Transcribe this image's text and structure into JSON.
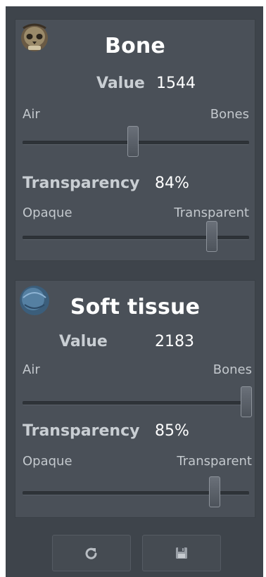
{
  "panels": [
    {
      "title": "Bone",
      "icon": "skull-icon",
      "value_label": "Value",
      "value": "1544",
      "value_slider": {
        "min_label": "Air",
        "max_label": "Bones",
        "level": 0.49
      },
      "transparency_label": "Transparency",
      "transparency_value": "84%",
      "transparency_slider": {
        "min_label": "Opaque",
        "max_label": "Transparent",
        "level": 0.84
      }
    },
    {
      "title": "Soft tissue",
      "icon": "head-icon",
      "value_label": "Value",
      "value": "2183",
      "value_slider": {
        "min_label": "Air",
        "max_label": "Bones",
        "level": 0.99
      },
      "transparency_label": "Transparency",
      "transparency_value": "85%",
      "transparency_slider": {
        "min_label": "Opaque",
        "max_label": "Transparent",
        "level": 0.85
      }
    }
  ],
  "actions": {
    "reset_icon": "reset-icon",
    "save_icon": "save-icon"
  },
  "colors": {
    "background": "#3e444b",
    "panel": "#4a5058",
    "text": "#ffffff",
    "muted_text": "#c3c8cd"
  }
}
